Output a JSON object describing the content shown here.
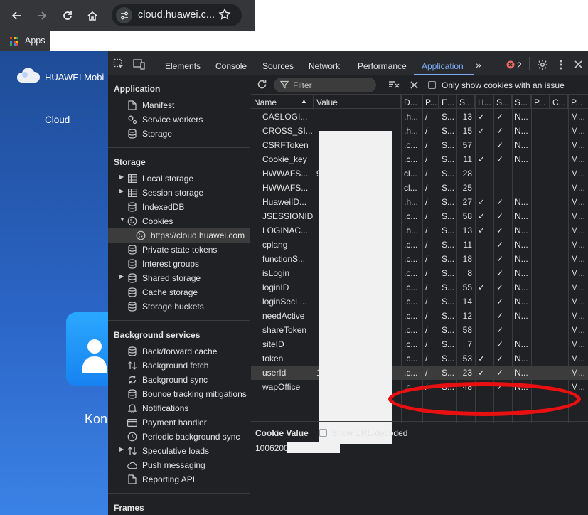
{
  "browser": {
    "url": "cloud.huawei.c...",
    "bookmarks_label": "Apps"
  },
  "page": {
    "brand": "HUAWEI Mobi",
    "nav_cloud": "Cloud",
    "partial_word": "Kon"
  },
  "devtools": {
    "tabs": [
      "Elements",
      "Console",
      "Sources",
      "Network",
      "Performance",
      "Application"
    ],
    "active_tab": "Application",
    "error_count": "2",
    "sidebar": {
      "application_header": "Application",
      "application_items": [
        "Manifest",
        "Service workers",
        "Storage"
      ],
      "storage_header": "Storage",
      "storage_items": [
        "Local storage",
        "Session storage",
        "IndexedDB",
        "Cookies",
        "https://cloud.huawei.com",
        "Private state tokens",
        "Interest groups",
        "Shared storage",
        "Cache storage",
        "Storage buckets"
      ],
      "background_header": "Background services",
      "background_items": [
        "Back/forward cache",
        "Background fetch",
        "Background sync",
        "Bounce tracking mitigations",
        "Notifications",
        "Payment handler",
        "Periodic background sync",
        "Speculative loads",
        "Push messaging",
        "Reporting API"
      ],
      "frames_header": "Frames"
    },
    "cookies": {
      "filter_placeholder": "Filter",
      "only_issues_label": "Only show cookies with an issue",
      "columns": [
        "Name",
        "Value",
        "D...",
        "P...",
        "E...",
        "S...",
        "H...",
        "S...",
        "S...",
        "P...",
        "C...",
        "P..."
      ],
      "rows": [
        {
          "name": "CASLOGI...",
          "value": "",
          "domain": ".h...",
          "path": "/",
          "expires": "S...",
          "size": "13",
          "http": "✓",
          "secure": "✓",
          "samesite": "N...",
          "priority": "M..."
        },
        {
          "name": "CROSS_SI...",
          "value": "",
          "domain": ".h...",
          "path": "/",
          "expires": "S...",
          "size": "15",
          "http": "✓",
          "secure": "✓",
          "samesite": "N...",
          "priority": "M..."
        },
        {
          "name": "CSRFToken",
          "value": "",
          "domain": ".c...",
          "path": "/",
          "expires": "S...",
          "size": "57",
          "http": "",
          "secure": "✓",
          "samesite": "N...",
          "priority": "M..."
        },
        {
          "name": "Cookie_key",
          "value": "",
          "domain": ".c...",
          "path": "/",
          "expires": "S...",
          "size": "11",
          "http": "✓",
          "secure": "✓",
          "samesite": "N...",
          "priority": "M..."
        },
        {
          "name": "HWWAFS...",
          "value": "9",
          "domain": "cl...",
          "path": "/",
          "expires": "S...",
          "size": "28",
          "http": "",
          "secure": "",
          "samesite": "",
          "priority": "M..."
        },
        {
          "name": "HWWAFS...",
          "value": "",
          "domain": "cl...",
          "path": "/",
          "expires": "S...",
          "size": "25",
          "http": "",
          "secure": "",
          "samesite": "",
          "priority": "M..."
        },
        {
          "name": "HuaweiID...",
          "value": "",
          "domain": ".h...",
          "path": "/",
          "expires": "S...",
          "size": "27",
          "http": "✓",
          "secure": "✓",
          "samesite": "N...",
          "priority": "M..."
        },
        {
          "name": "JSESSIONID",
          "value": "",
          "domain": ".c...",
          "path": "/",
          "expires": "S...",
          "size": "58",
          "http": "✓",
          "secure": "✓",
          "samesite": "N...",
          "priority": "M..."
        },
        {
          "name": "LOGINAC...",
          "value": "",
          "domain": ".h...",
          "path": "/",
          "expires": "S...",
          "size": "13",
          "http": "✓",
          "secure": "✓",
          "samesite": "N...",
          "priority": "M..."
        },
        {
          "name": "cplang",
          "value": "",
          "domain": ".c...",
          "path": "/",
          "expires": "S...",
          "size": "11",
          "http": "",
          "secure": "✓",
          "samesite": "N...",
          "priority": "M..."
        },
        {
          "name": "functionS...",
          "value": "",
          "domain": ".c...",
          "path": "/",
          "expires": "S...",
          "size": "18",
          "http": "",
          "secure": "✓",
          "samesite": "N...",
          "priority": "M..."
        },
        {
          "name": "isLogin",
          "value": "",
          "domain": ".c...",
          "path": "/",
          "expires": "S...",
          "size": "8",
          "http": "",
          "secure": "✓",
          "samesite": "N...",
          "priority": "M..."
        },
        {
          "name": "loginID",
          "value": "",
          "domain": ".c...",
          "path": "/",
          "expires": "S...",
          "size": "55",
          "http": "✓",
          "secure": "✓",
          "samesite": "N...",
          "priority": "M..."
        },
        {
          "name": "loginSecL...",
          "value": "",
          "domain": ".c...",
          "path": "/",
          "expires": "S...",
          "size": "14",
          "http": "",
          "secure": "✓",
          "samesite": "N...",
          "priority": "M..."
        },
        {
          "name": "needActive",
          "value": "",
          "domain": ".c...",
          "path": "/",
          "expires": "S...",
          "size": "12",
          "http": "",
          "secure": "✓",
          "samesite": "N...",
          "priority": "M..."
        },
        {
          "name": "shareToken",
          "value": "",
          "domain": ".c...",
          "path": "/",
          "expires": "S...",
          "size": "58",
          "http": "",
          "secure": "✓",
          "samesite": "",
          "priority": "M..."
        },
        {
          "name": "siteID",
          "value": "",
          "domain": ".c...",
          "path": "/",
          "expires": "S...",
          "size": "7",
          "http": "",
          "secure": "✓",
          "samesite": "N...",
          "priority": "M..."
        },
        {
          "name": "token",
          "value": "",
          "domain": ".c...",
          "path": "/",
          "expires": "S...",
          "size": "53",
          "http": "✓",
          "secure": "✓",
          "samesite": "N...",
          "priority": "M..."
        },
        {
          "name": "userId",
          "value": "1006200",
          "domain": ".c...",
          "path": "/",
          "expires": "S...",
          "size": "23",
          "http": "✓",
          "secure": "✓",
          "samesite": "N...",
          "priority": "M..."
        },
        {
          "name": "wapOffice",
          "value": "",
          "domain": ".c...",
          "path": "/",
          "expires": "S...",
          "size": "48",
          "http": "",
          "secure": "✓",
          "samesite": "N...",
          "priority": "M..."
        }
      ],
      "value_pane": {
        "label": "Cookie Value",
        "show_decoded_label": "Show URL-decoded",
        "value": "1006200"
      }
    }
  },
  "colors": {
    "annotation_red": "#e81010",
    "accent_blue": "#7cacf8",
    "devtools_bg": "#202124"
  }
}
